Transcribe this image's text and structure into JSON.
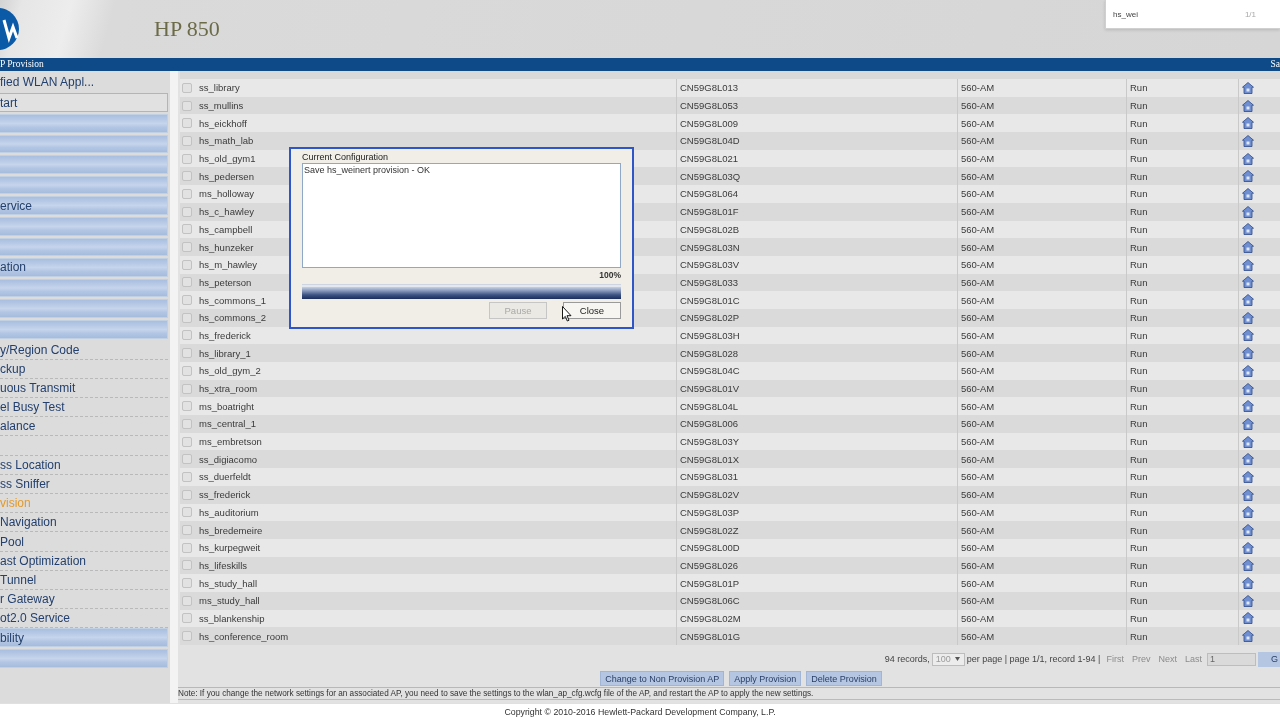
{
  "header": {
    "title": "HP 850",
    "find_bar": {
      "query": "hs_wei",
      "count": "1/1"
    }
  },
  "nav_bar": {
    "title": "P Provision",
    "right_text": "Sa"
  },
  "sidebar": {
    "items": [
      {
        "kind": "text",
        "label": "fied WLAN Appl..."
      },
      {
        "kind": "button",
        "label": "tart"
      },
      {
        "kind": "bar"
      },
      {
        "kind": "bar"
      },
      {
        "kind": "bar"
      },
      {
        "kind": "bar"
      },
      {
        "kind": "bar",
        "label": "ervice"
      },
      {
        "kind": "bar"
      },
      {
        "kind": "bar"
      },
      {
        "kind": "bar",
        "label": "ation"
      },
      {
        "kind": "bar"
      },
      {
        "kind": "bar"
      },
      {
        "kind": "bar"
      },
      {
        "kind": "link",
        "label": "y/Region Code",
        "selected": false
      },
      {
        "kind": "link",
        "label": "ckup",
        "selected": false
      },
      {
        "kind": "link",
        "label": "uous Transmit",
        "selected": false
      },
      {
        "kind": "link",
        "label": "el Busy Test",
        "selected": false
      },
      {
        "kind": "link",
        "label": "alance",
        "selected": false
      },
      {
        "kind": "blank"
      },
      {
        "kind": "link",
        "label": "ss Location",
        "selected": false
      },
      {
        "kind": "link",
        "label": "ss Sniffer",
        "selected": false
      },
      {
        "kind": "link",
        "label": "vision",
        "selected": true
      },
      {
        "kind": "link",
        "label": "Navigation",
        "selected": false
      },
      {
        "kind": "link",
        "label": "Pool",
        "selected": false
      },
      {
        "kind": "link",
        "label": "ast Optimization",
        "selected": false
      },
      {
        "kind": "link",
        "label": "Tunnel",
        "selected": false
      },
      {
        "kind": "link",
        "label": "r Gateway",
        "selected": false
      },
      {
        "kind": "link",
        "label": "ot2.0 Service",
        "selected": false
      },
      {
        "kind": "bar",
        "label": "bility"
      },
      {
        "kind": "bar"
      }
    ]
  },
  "table": {
    "rows": [
      {
        "checked": false,
        "cells": [
          "ss_library",
          "CN59G8L013",
          "560-AM",
          "Run"
        ]
      },
      {
        "checked": false,
        "cells": [
          "ss_mullins",
          "CN59G8L053",
          "560-AM",
          "Run"
        ]
      },
      {
        "checked": false,
        "cells": [
          "hs_eickhoff",
          "CN59G8L009",
          "560-AM",
          "Run"
        ]
      },
      {
        "checked": false,
        "cells": [
          "hs_math_lab",
          "CN59G8L04D",
          "560-AM",
          "Run"
        ]
      },
      {
        "checked": false,
        "cells": [
          "hs_old_gym1",
          "CN59G8L021",
          "560-AM",
          "Run"
        ]
      },
      {
        "checked": false,
        "cells": [
          "hs_pedersen",
          "CN59G8L03Q",
          "560-AM",
          "Run"
        ]
      },
      {
        "checked": false,
        "cells": [
          "ms_holloway",
          "CN59G8L064",
          "560-AM",
          "Run"
        ]
      },
      {
        "checked": false,
        "cells": [
          "hs_c_hawley",
          "CN59G8L01F",
          "560-AM",
          "Run"
        ]
      },
      {
        "checked": false,
        "cells": [
          "hs_campbell",
          "CN59G8L02B",
          "560-AM",
          "Run"
        ]
      },
      {
        "checked": false,
        "cells": [
          "hs_hunzeker",
          "CN59G8L03N",
          "560-AM",
          "Run"
        ]
      },
      {
        "checked": false,
        "cells": [
          "hs_m_hawley",
          "CN59G8L03V",
          "560-AM",
          "Run"
        ]
      },
      {
        "checked": false,
        "cells": [
          "hs_peterson",
          "CN59G8L033",
          "560-AM",
          "Run"
        ]
      },
      {
        "checked": false,
        "cells": [
          "hs_commons_1",
          "CN59G8L01C",
          "560-AM",
          "Run"
        ]
      },
      {
        "checked": false,
        "cells": [
          "hs_commons_2",
          "CN59G8L02P",
          "560-AM",
          "Run"
        ]
      },
      {
        "checked": false,
        "cells": [
          "hs_frederick",
          "CN59G8L03H",
          "560-AM",
          "Run"
        ]
      },
      {
        "checked": false,
        "cells": [
          "hs_library_1",
          "CN59G8L028",
          "560-AM",
          "Run"
        ]
      },
      {
        "checked": false,
        "cells": [
          "hs_old_gym_2",
          "CN59G8L04C",
          "560-AM",
          "Run"
        ]
      },
      {
        "checked": false,
        "cells": [
          "hs_xtra_room",
          "CN59G8L01V",
          "560-AM",
          "Run"
        ]
      },
      {
        "checked": false,
        "cells": [
          "ms_boatright",
          "CN59G8L04L",
          "560-AM",
          "Run"
        ]
      },
      {
        "checked": false,
        "cells": [
          "ms_central_1",
          "CN59G8L006",
          "560-AM",
          "Run"
        ]
      },
      {
        "checked": false,
        "cells": [
          "ms_embretson",
          "CN59G8L03Y",
          "560-AM",
          "Run"
        ]
      },
      {
        "checked": false,
        "cells": [
          "ss_digiacomo",
          "CN59G8L01X",
          "560-AM",
          "Run"
        ]
      },
      {
        "checked": false,
        "cells": [
          "ss_duerfeldt",
          "CN59G8L031",
          "560-AM",
          "Run"
        ]
      },
      {
        "checked": false,
        "cells": [
          "ss_frederick",
          "CN59G8L02V",
          "560-AM",
          "Run"
        ]
      },
      {
        "checked": false,
        "cells": [
          "hs_auditorium",
          "CN59G8L03P",
          "560-AM",
          "Run"
        ]
      },
      {
        "checked": false,
        "cells": [
          "hs_bredemeire",
          "CN59G8L02Z",
          "560-AM",
          "Run"
        ]
      },
      {
        "checked": false,
        "cells": [
          "hs_kurpegweit",
          "CN59G8L00D",
          "560-AM",
          "Run"
        ]
      },
      {
        "checked": false,
        "cells": [
          "hs_lifeskills",
          "CN59G8L026",
          "560-AM",
          "Run"
        ]
      },
      {
        "checked": false,
        "cells": [
          "hs_study_hall",
          "CN59G8L01P",
          "560-AM",
          "Run"
        ]
      },
      {
        "checked": false,
        "cells": [
          "ms_study_hall",
          "CN59G8L06C",
          "560-AM",
          "Run"
        ]
      },
      {
        "checked": false,
        "cells": [
          "ss_blankenship",
          "CN59G8L02M",
          "560-AM",
          "Run"
        ]
      },
      {
        "checked": false,
        "cells": [
          "hs_conference_room",
          "CN59G8L01G",
          "560-AM",
          "Run"
        ]
      }
    ]
  },
  "pagination": {
    "records": "94 records,",
    "per_page": "100",
    "summary": "per page | page 1/1, record 1-94 |",
    "links": [
      {
        "label": "First",
        "disabled": true
      },
      {
        "label": "Prev",
        "disabled": true
      },
      {
        "label": "Next",
        "disabled": true
      },
      {
        "label": "Last",
        "disabled": true
      }
    ],
    "page": "1",
    "go": "G"
  },
  "actions": [
    "Change to Non Provision AP",
    "Apply Provision",
    "Delete Provision"
  ],
  "note": "Note: If you change the network settings for an associated AP, you need to save the settings to the wlan_ap_cfg.wcfg file of the AP, and restart the AP to apply the new settings.",
  "copyright": "Copyright © 2010-2016 Hewlett-Packard Development Company, L.P.",
  "dialog": {
    "label": "Current Configuration",
    "log": "Save hs_weinert provision - OK",
    "percent": "100%",
    "level": 1,
    "buttons": [
      {
        "label": "Pause",
        "disabled": true
      },
      {
        "label": "Close",
        "disabled": false
      }
    ]
  }
}
